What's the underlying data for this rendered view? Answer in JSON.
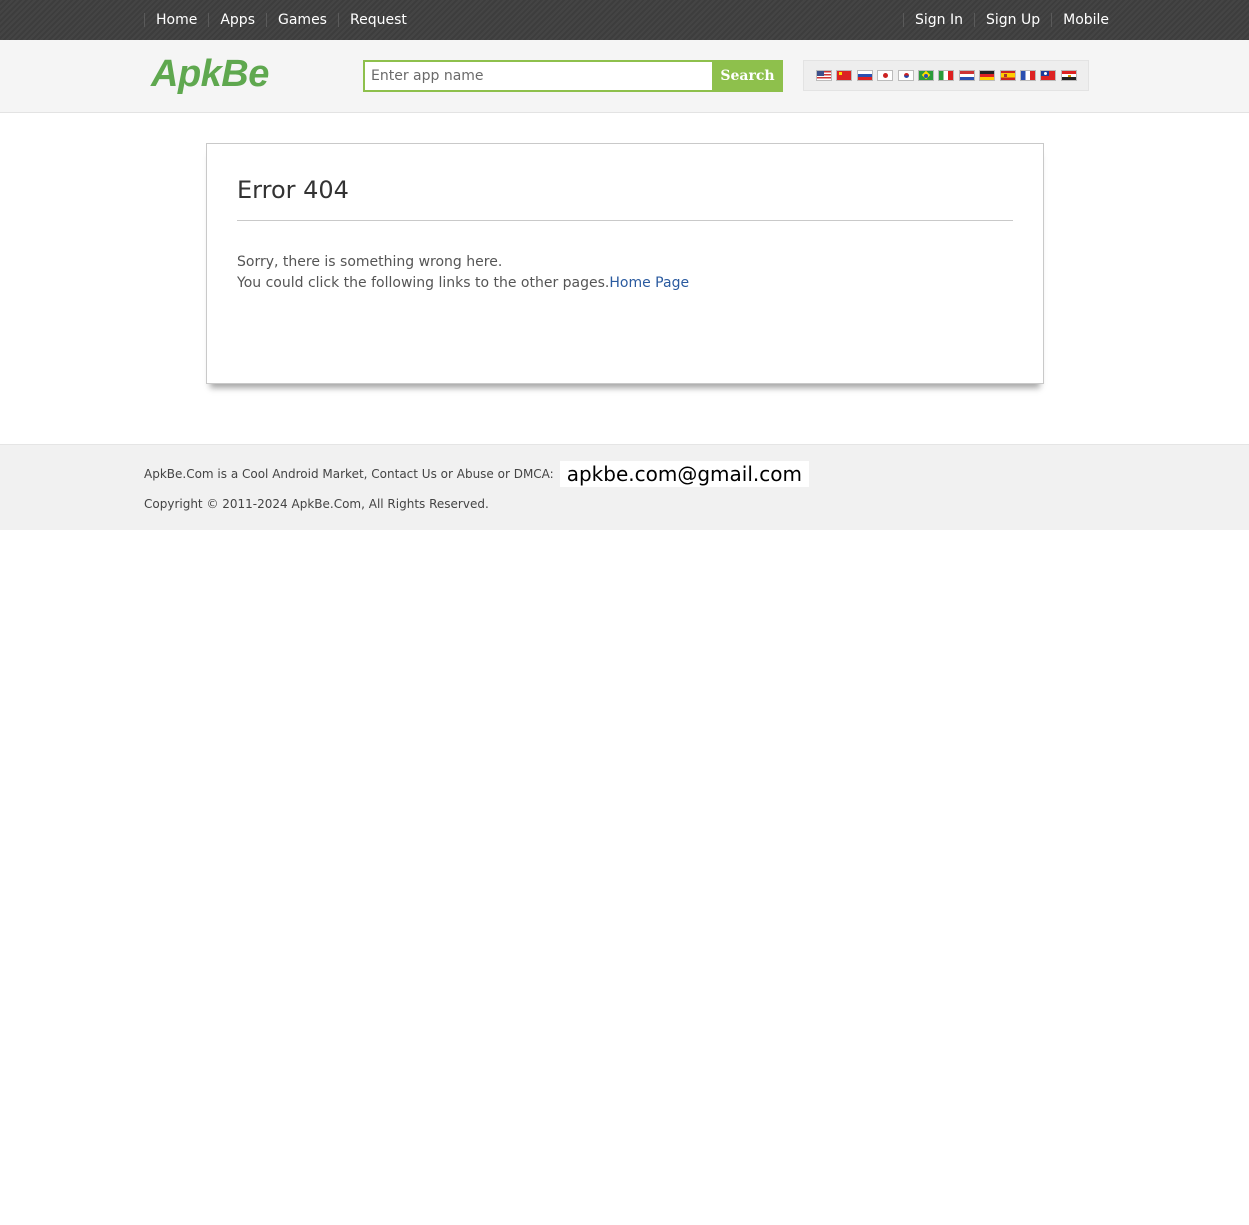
{
  "topnav": {
    "left": [
      "Home",
      "Apps",
      "Games",
      "Request"
    ],
    "right": [
      "Sign In",
      "Sign Up",
      "Mobile"
    ]
  },
  "header": {
    "logo": "ApkBe",
    "search_placeholder": "Enter app name",
    "search_button": "Search",
    "flags": [
      "us-flag-icon",
      "cn-flag-icon",
      "ru-flag-icon",
      "jp-flag-icon",
      "kr-flag-icon",
      "br-flag-icon",
      "it-flag-icon",
      "nl-flag-icon",
      "de-flag-icon",
      "es-flag-icon",
      "fr-flag-icon",
      "tw-flag-icon",
      "eg-flag-icon"
    ]
  },
  "error": {
    "title": "Error 404",
    "line1": "Sorry, there is something wrong here.",
    "line2": "You could click the following links to the other pages.",
    "home_link": "Home Page"
  },
  "footer": {
    "contact_text": "ApkBe.Com is a Cool Android Market, Contact Us or Abuse or DMCA:",
    "email": "apkbe.com@gmail.com",
    "copyright": "Copyright © 2011-2024 ApkBe.Com, All Rights Reserved."
  },
  "colors": {
    "brand_green": "#5fa84f",
    "search_green": "#8ec04c",
    "topbar": "#3d3d3d",
    "link_blue": "#2a5a9f"
  }
}
